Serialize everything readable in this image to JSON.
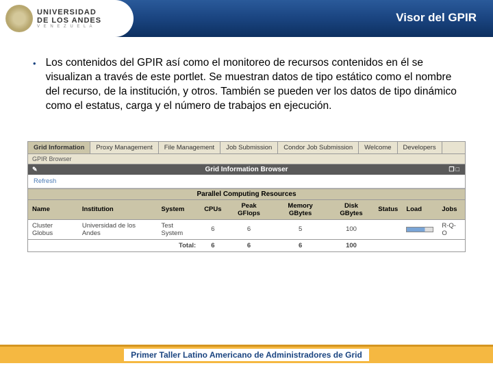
{
  "header": {
    "logo_top": "UNIVERSIDAD",
    "logo_mid": "DE LOS ANDES",
    "logo_sub": "V E N E Z U E L A",
    "title": "Visor del GPIR"
  },
  "bullet": "Los contenidos del GPIR así como el monitoreo de recursos contenidos en él se visualizan a través de este portlet. Se muestran datos de tipo estático como el nombre del recurso, de la institución, y otros. También se pueden ver los datos de tipo dinámico como el estatus, carga y el número de trabajos en ejecución.",
  "portlet": {
    "tabs": [
      "Grid Information",
      "Proxy Management",
      "File Management",
      "Job Submission",
      "Condor Job Submission",
      "Welcome",
      "Developers"
    ],
    "subtab": "GPIR Browser",
    "title": "Grid Information Browser",
    "refresh": "Refresh",
    "section": "Parallel Computing Resources",
    "cols": [
      "Name",
      "Institution",
      "System",
      "CPUs",
      "Peak GFlops",
      "Memory GBytes",
      "Disk GBytes",
      "Status",
      "Load",
      "Jobs"
    ],
    "row": {
      "name": "Cluster Globus",
      "inst": "Universidad de los Andes",
      "sys": "Test System",
      "cpus": "6",
      "gflops": "6",
      "mem": "5",
      "disk": "100",
      "status": "",
      "jobs": "R-Q-O"
    },
    "total_label": "Total:",
    "total": {
      "cpus": "6",
      "gflops": "6",
      "mem": "6",
      "disk": "100"
    }
  },
  "footer": "Primer Taller Latino Americano de Administradores de Grid"
}
